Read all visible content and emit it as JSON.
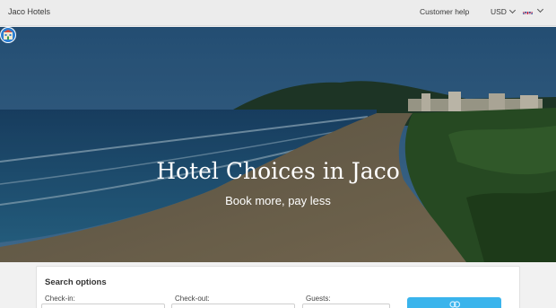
{
  "header": {
    "brand": "Jaco Hotels",
    "customer_help": "Customer help",
    "currency": "USD",
    "language_icon": "uk-flag-icon"
  },
  "hero": {
    "title": "Hotel Choices in Jaco",
    "subtitle": "Book more, pay less"
  },
  "search": {
    "title": "Search options",
    "checkin_label": "Check-in:",
    "checkout_label": "Check-out:",
    "guests_label": "Guests:",
    "button_icon": "search-icon"
  },
  "colors": {
    "accent": "#3ab4ec",
    "topbar": "#ececec"
  }
}
